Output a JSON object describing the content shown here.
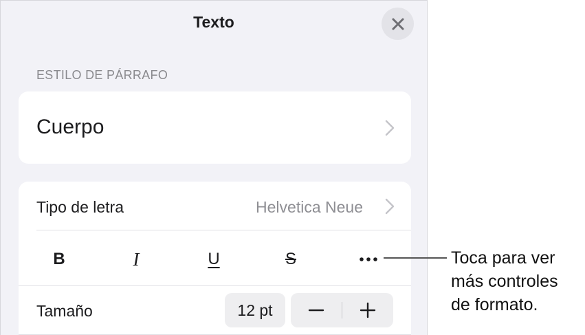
{
  "panel": {
    "title": "Texto",
    "close_icon": "close-icon"
  },
  "paragraph_style": {
    "header": "ESTILO DE PÁRRAFO",
    "value": "Cuerpo"
  },
  "font": {
    "label": "Tipo de letra",
    "value": "Helvetica Neue"
  },
  "format_buttons": {
    "bold": "B",
    "italic": "I",
    "underline": "U",
    "strikethrough": "S",
    "more_icon": "ellipsis-icon"
  },
  "size": {
    "label": "Tamaño",
    "value": "12 pt",
    "decrease_icon": "minus-icon",
    "increase_icon": "plus-icon"
  },
  "callout": {
    "lines": [
      "Toca para ver",
      "más controles",
      "de formato."
    ]
  },
  "colors": {
    "panel_bg": "#f2f2f7",
    "card_bg": "#ffffff",
    "secondary_text": "#8e8e93",
    "close_button_bg": "#e3e3e8"
  }
}
